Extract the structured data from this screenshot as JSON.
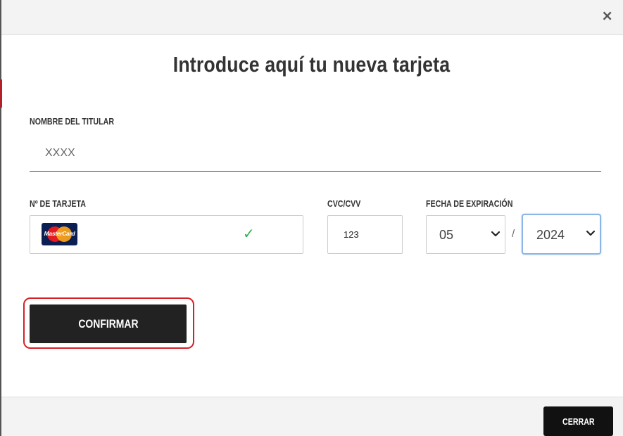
{
  "modal": {
    "close_symbol": "×",
    "title": "Introduce aquí tu nueva tarjeta"
  },
  "form": {
    "holder_label": "NOMBRE DEL TITULAR",
    "holder_placeholder": "XXXX",
    "card_label": "Nº DE TARJETA",
    "card_brand": "MasterCard",
    "card_valid_icon": "checkmark-icon",
    "cvc_label": "CVC/CVV",
    "cvc_value": "123",
    "expiry_label": "FECHA DE EXPIRACIÓN",
    "expiry_month": "05",
    "expiry_separator": "/",
    "expiry_year": "2024"
  },
  "actions": {
    "confirm_label": "CONFIRMAR",
    "close_label": "CERRAR"
  },
  "colors": {
    "primary_button": "#222222",
    "highlight": "#d62027",
    "valid_check": "#2bb24c"
  }
}
